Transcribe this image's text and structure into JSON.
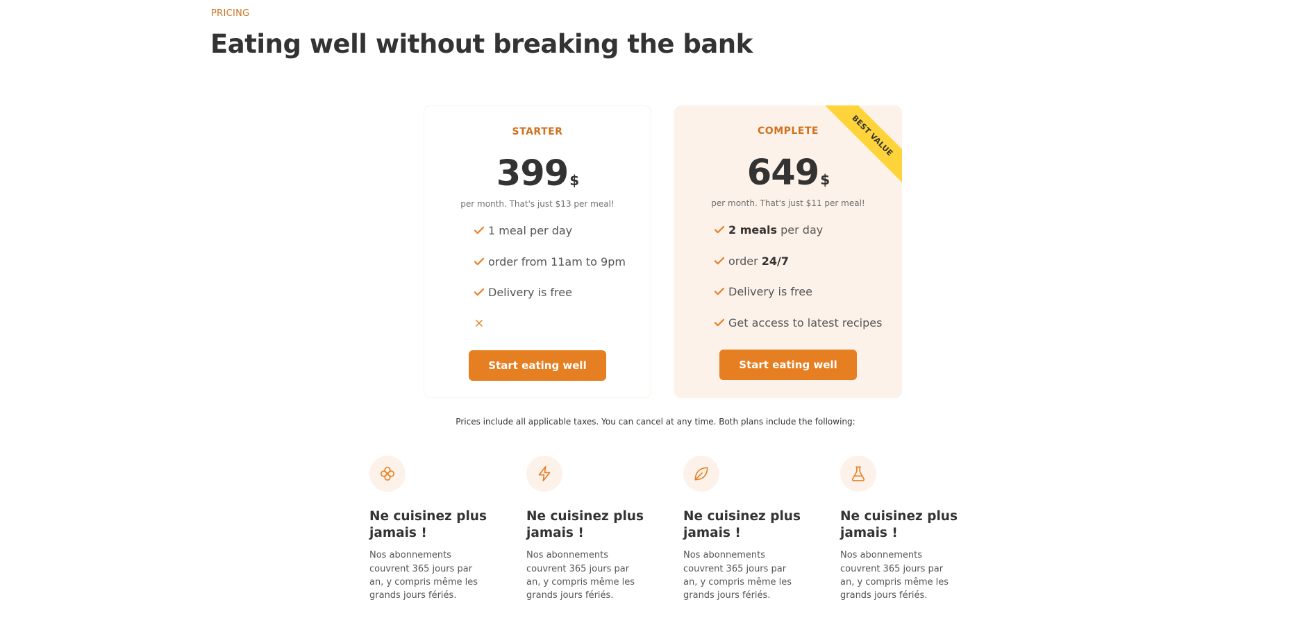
{
  "header": {
    "section_label": "PRICING",
    "title": "Eating well without breaking the bank"
  },
  "plans": [
    {
      "name": "STARTER",
      "price": "399",
      "currency": "$",
      "note": "per month. That's just $13 per meal!",
      "features": [
        {
          "icon": "check-icon",
          "text": "1 meal per day"
        },
        {
          "icon": "check-icon",
          "text": "order from 11am to 9pm"
        },
        {
          "icon": "check-icon",
          "text": "Delivery is free"
        },
        {
          "icon": "close-icon",
          "text": ""
        }
      ],
      "cta": "Start eating well"
    },
    {
      "name": "COMPLETE",
      "badge": "BEST VALUE",
      "price": "649",
      "currency": "$",
      "note": "per month. That's just $11 per meal!",
      "features": [
        {
          "icon": "check-icon",
          "strong": "2 meals",
          "text": " per day"
        },
        {
          "icon": "check-icon",
          "prefix": "order ",
          "strong": "24/7"
        },
        {
          "icon": "check-icon",
          "text": "Delivery is free"
        },
        {
          "icon": "check-icon",
          "text": "Get access to latest recipes"
        }
      ],
      "cta": "Start eating well"
    }
  ],
  "pricing_note": "Prices include all applicable taxes. You can cancel at any time. Both plans include the following:",
  "features": [
    {
      "icon": "infinity-icon",
      "title": "Ne cuisinez plus jamais !",
      "text": "Nos abonnements couvrent 365 jours par an, y compris même les grands jours fériés."
    },
    {
      "icon": "lightning-icon",
      "title": "Ne cuisinez plus jamais !",
      "text": "Nos abonnements couvrent 365 jours par an, y compris même les grands jours fériés."
    },
    {
      "icon": "leaf-icon",
      "title": "Ne cuisinez plus jamais !",
      "text": "Nos abonnements couvrent 365 jours par an, y compris même les grands jours fériés."
    },
    {
      "icon": "flask-icon",
      "title": "Ne cuisinez plus jamais !",
      "text": "Nos abonnements couvrent 365 jours par an, y compris même les grands jours fériés."
    }
  ],
  "colors": {
    "accent": "#e67e22",
    "accent_text": "#cf711f",
    "tint": "#fdf2e9",
    "ribbon": "#ffd43b",
    "text": "#333333"
  }
}
